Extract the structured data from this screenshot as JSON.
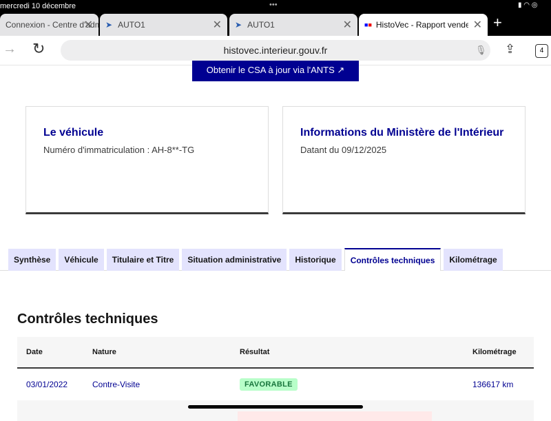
{
  "status": {
    "date": "mercredi 10 décembre",
    "dots": "•••"
  },
  "browser_tabs": [
    {
      "label": "Connexion - Centre d'adm"
    },
    {
      "label": "AUTO1"
    },
    {
      "label": "AUTO1"
    },
    {
      "label": "HistoVec - Rapport vendeur",
      "active": true
    }
  ],
  "address": {
    "url": "histovec.interieur.gouv.fr",
    "tab_count": "4"
  },
  "page": {
    "csa_button": "Obtenir le CSA à jour via l'ANTS ↗",
    "card_vehicle": {
      "title": "Le véhicule",
      "text": "Numéro d'immatriculation : AH-8**-TG"
    },
    "card_ministry": {
      "title": "Informations du Ministère de l'Intérieur",
      "text": "Datant du 09/12/2025"
    },
    "tabs": [
      "Synthèse",
      "Véhicule",
      "Titulaire et Titre",
      "Situation administrative",
      "Historique",
      "Contrôles techniques",
      "Kilométrage"
    ],
    "section_title": "Contrôles techniques",
    "table": {
      "headers": [
        "Date",
        "Nature",
        "Résultat",
        "Kilométrage"
      ],
      "rows": [
        {
          "date": "03/01/2022",
          "nature": "Contre-Visite",
          "result": "FAVORABLE",
          "km": "136617 km"
        }
      ]
    }
  }
}
